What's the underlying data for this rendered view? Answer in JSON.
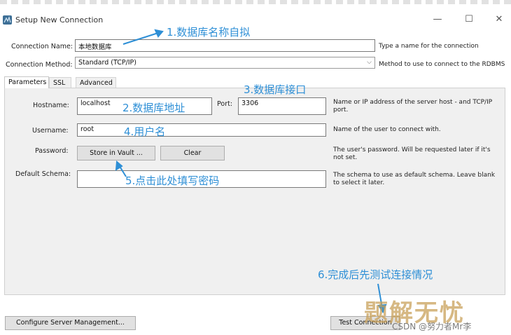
{
  "window": {
    "title": "Setup New Connection",
    "minimize_glyph": "—",
    "maximize_glyph": "☐",
    "close_glyph": "✕"
  },
  "connection_name": {
    "label": "Connection Name:",
    "value": "本地数据库",
    "hint": "Type a name for the connection"
  },
  "connection_method": {
    "label": "Connection Method:",
    "value": "Standard (TCP/IP)",
    "hint": "Method to use to connect to the RDBMS"
  },
  "tabs": [
    {
      "label": "Parameters",
      "active": true
    },
    {
      "label": "SSL",
      "active": false
    },
    {
      "label": "Advanced",
      "active": false
    }
  ],
  "params": {
    "hostname": {
      "label": "Hostname:",
      "value": "localhost",
      "hint": "Name or IP address of the server host - and TCP/IP port."
    },
    "port": {
      "label": "Port:",
      "value": "3306"
    },
    "username": {
      "label": "Username:",
      "value": "root",
      "hint": "Name of the user to connect with."
    },
    "password": {
      "label": "Password:",
      "store_button": "Store in Vault ...",
      "clear_button": "Clear",
      "hint": "The user's password. Will be requested later if it's not set."
    },
    "default_schema": {
      "label": "Default Schema:",
      "value": "",
      "hint": "The schema to use as default schema. Leave blank to select it later."
    }
  },
  "footer": {
    "configure_button": "Configure Server Management...",
    "test_button": "Test Connection"
  },
  "annotations": {
    "a1": "1.数据库名称自拟",
    "a2": "2.数据库地址",
    "a3": "3.数据库接口",
    "a4": "4.用户名",
    "a5": "5.点击此处填写密码",
    "a6": "6.完成后先测试连接情况"
  },
  "overlay": {
    "watermark": "题解无忧",
    "credit": "CSDN @努力者Mr李"
  },
  "colors": {
    "annotation": "#2e8fd6",
    "panel": "#f0f0f0",
    "button": "#e1e1e1"
  }
}
